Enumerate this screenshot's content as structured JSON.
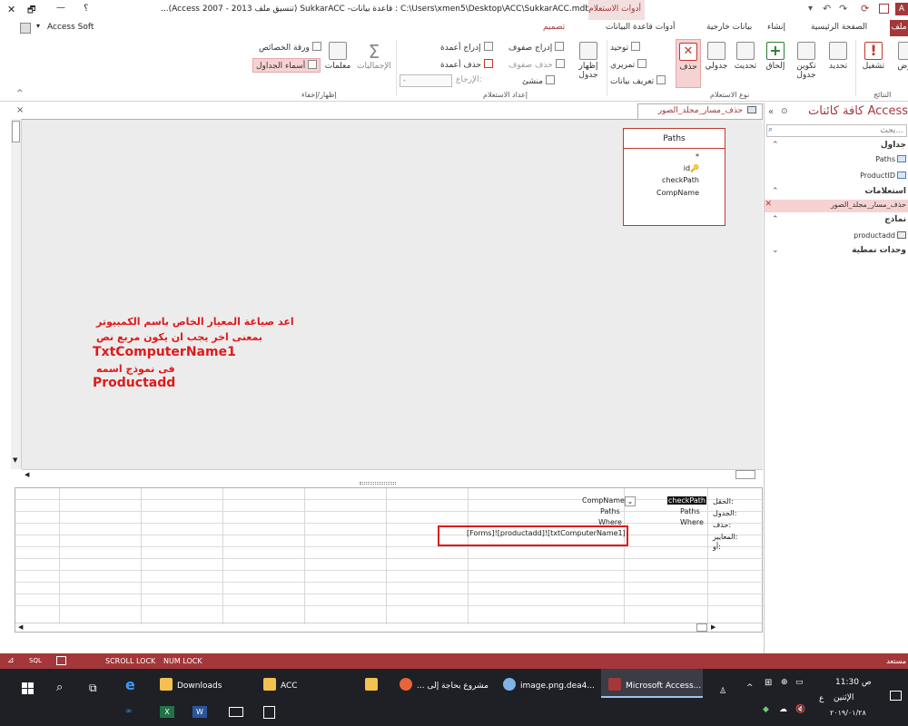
{
  "window": {
    "title": "C:\\Users\\xmen5\\Desktop\\ACC\\SukkarACC.mdb : قاعدة بيانات- SukkarACC (تنسيق ملف Access 2007 - 2013)...",
    "context_tab": "أدوات الاستعلام",
    "account": "Access Soft",
    "help": "؟",
    "minimize": "—",
    "restore": "🗗",
    "close": "✕"
  },
  "tabs": [
    "ملف",
    "الصفحة الرئيسية",
    "إنشاء",
    "بيانات خارجية",
    "أدوات قاعدة البيانات",
    "تصميم"
  ],
  "ribbon": {
    "results": {
      "label": "النتائج",
      "buttons": [
        "عرض",
        "تشغيل"
      ]
    },
    "query_type": {
      "label": "نوع الاستعلام",
      "buttons": [
        "تحديد",
        "تكوين جدول",
        "إلحاق",
        "تحديث",
        "جدولي",
        "حذف"
      ],
      "small": [
        "توحيد",
        "تمريري",
        "تعريف بيانات"
      ]
    },
    "setup": {
      "label": "إعداد الاستعلام",
      "show_table": "إظهار جدول",
      "small": [
        "إدراج صفوف",
        "حذف صفوف",
        "منشئ",
        "إدراج أعمدة",
        "حذف أعمدة",
        "الإرجاع:"
      ],
      "return_value": "-"
    },
    "show_hide": {
      "label": "إظهار/إخفاء",
      "totals": "الإجماليات",
      "parameters": "معلمات",
      "property_sheet": "ورقة الخصائص",
      "table_names": "أسماء الجداول"
    }
  },
  "nav": {
    "header": "كافة كائنات Access",
    "search_placeholder": "بحث...",
    "categories": [
      {
        "name": "جداول",
        "items": [
          "Paths",
          "ProductID"
        ]
      },
      {
        "name": "استعلامات",
        "items": [
          "حذف_مسار_مجلد_الصور"
        ]
      },
      {
        "name": "نماذج",
        "items": [
          "productadd"
        ]
      },
      {
        "name": "وحدات نمطية",
        "items": []
      }
    ]
  },
  "document": {
    "tab_title": "حذف_مسار_مجلد_الصور",
    "field_list": {
      "table": "Paths",
      "fields": [
        "*",
        "id",
        "checkPath",
        "CompName"
      ]
    },
    "annotation": [
      "اعد صياغة المعيار الخاص باسم الكمبيوتر",
      "بمعنى اخر يجب ان يكون مربع نص",
      "TxtComputerName1",
      "فى نموذج اسمه",
      "Productadd"
    ]
  },
  "grid": {
    "row_labels": [
      "الحقل:",
      "الجدول:",
      "حذف:",
      "المعايير:",
      "أو:"
    ],
    "columns": [
      {
        "field": "checkPath",
        "table": "Paths",
        "delete": "Where",
        "criteria": ""
      },
      {
        "field": "CompName",
        "table": "Paths",
        "delete": "Where",
        "criteria": "[Forms]![productadd]![txtComputerName1]"
      }
    ]
  },
  "statusbar": {
    "left": "مستعد",
    "indicators": [
      "SCROLL LOCK",
      "NUM LOCK"
    ],
    "view_labels": [
      "SQL"
    ]
  },
  "taskbar": {
    "items": [
      "Downloads",
      "ACC",
      "... مشروع بحاجة إلى",
      "image.png.dea4...",
      "Microsoft Access..."
    ],
    "time": "11:30 ص",
    "day": "الإثنين",
    "date": "٢٠١٩/٠١/٢٨",
    "lang": "ع"
  }
}
